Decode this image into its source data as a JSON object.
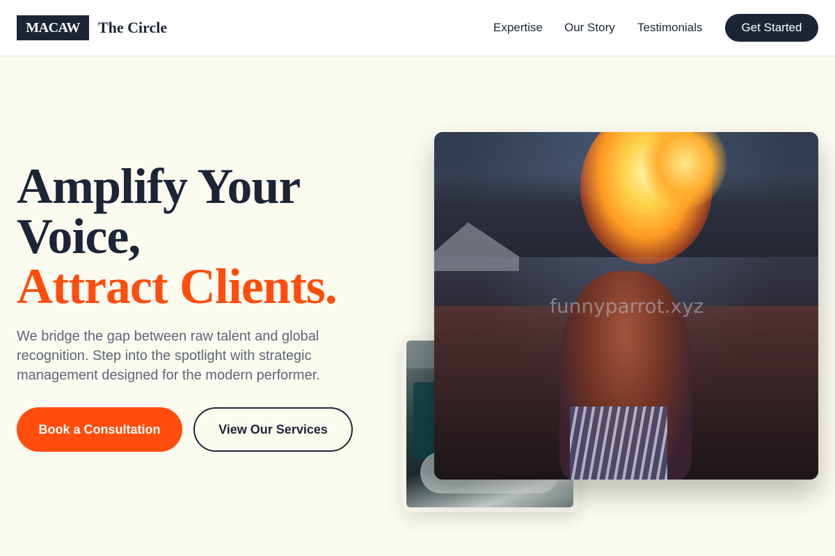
{
  "header": {
    "logo_text": "MACAW",
    "brand_name": "The Circle",
    "nav": [
      "Expertise",
      "Our Story",
      "Testimonials"
    ],
    "cta_label": "Get Started"
  },
  "hero": {
    "headline_line1": "Amplify Your",
    "headline_line2": "Voice,",
    "headline_accent": "Attract Clients.",
    "subtext": "We bridge the gap between raw talent and global recognition. Step into the spotlight with strategic management designed for the modern performer.",
    "primary_button": "Book a Consultation",
    "secondary_button": "View Our Services"
  },
  "images": {
    "main_watermark": "funnyparrot.xyz"
  },
  "colors": {
    "navy": "#1c2536",
    "accent": "#ff4d0d",
    "background": "#fbfbf0"
  }
}
